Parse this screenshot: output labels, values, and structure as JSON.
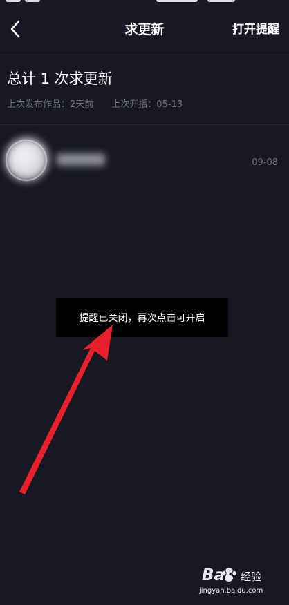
{
  "nav": {
    "title": "求更新",
    "open_remind_label": "打开提醒",
    "back_icon": "chevron-left-icon"
  },
  "summary": {
    "title": "总计 1 次求更新",
    "last_post": "上次发布作品：2天前",
    "last_live": "上次开播：05-13"
  },
  "list": {
    "items": [
      {
        "name": "",
        "date": "09-08"
      }
    ]
  },
  "toast": {
    "message": "提醒已关闭，再次点击可开启"
  },
  "watermark": {
    "brand": "Bai",
    "brand_suffix": "经验",
    "url": "jingyan.baidu.com"
  },
  "colors": {
    "background": "#171824",
    "muted_text": "#6c6e7b",
    "toast_bg": "#000000",
    "annotation_arrow": "#e8202c"
  }
}
